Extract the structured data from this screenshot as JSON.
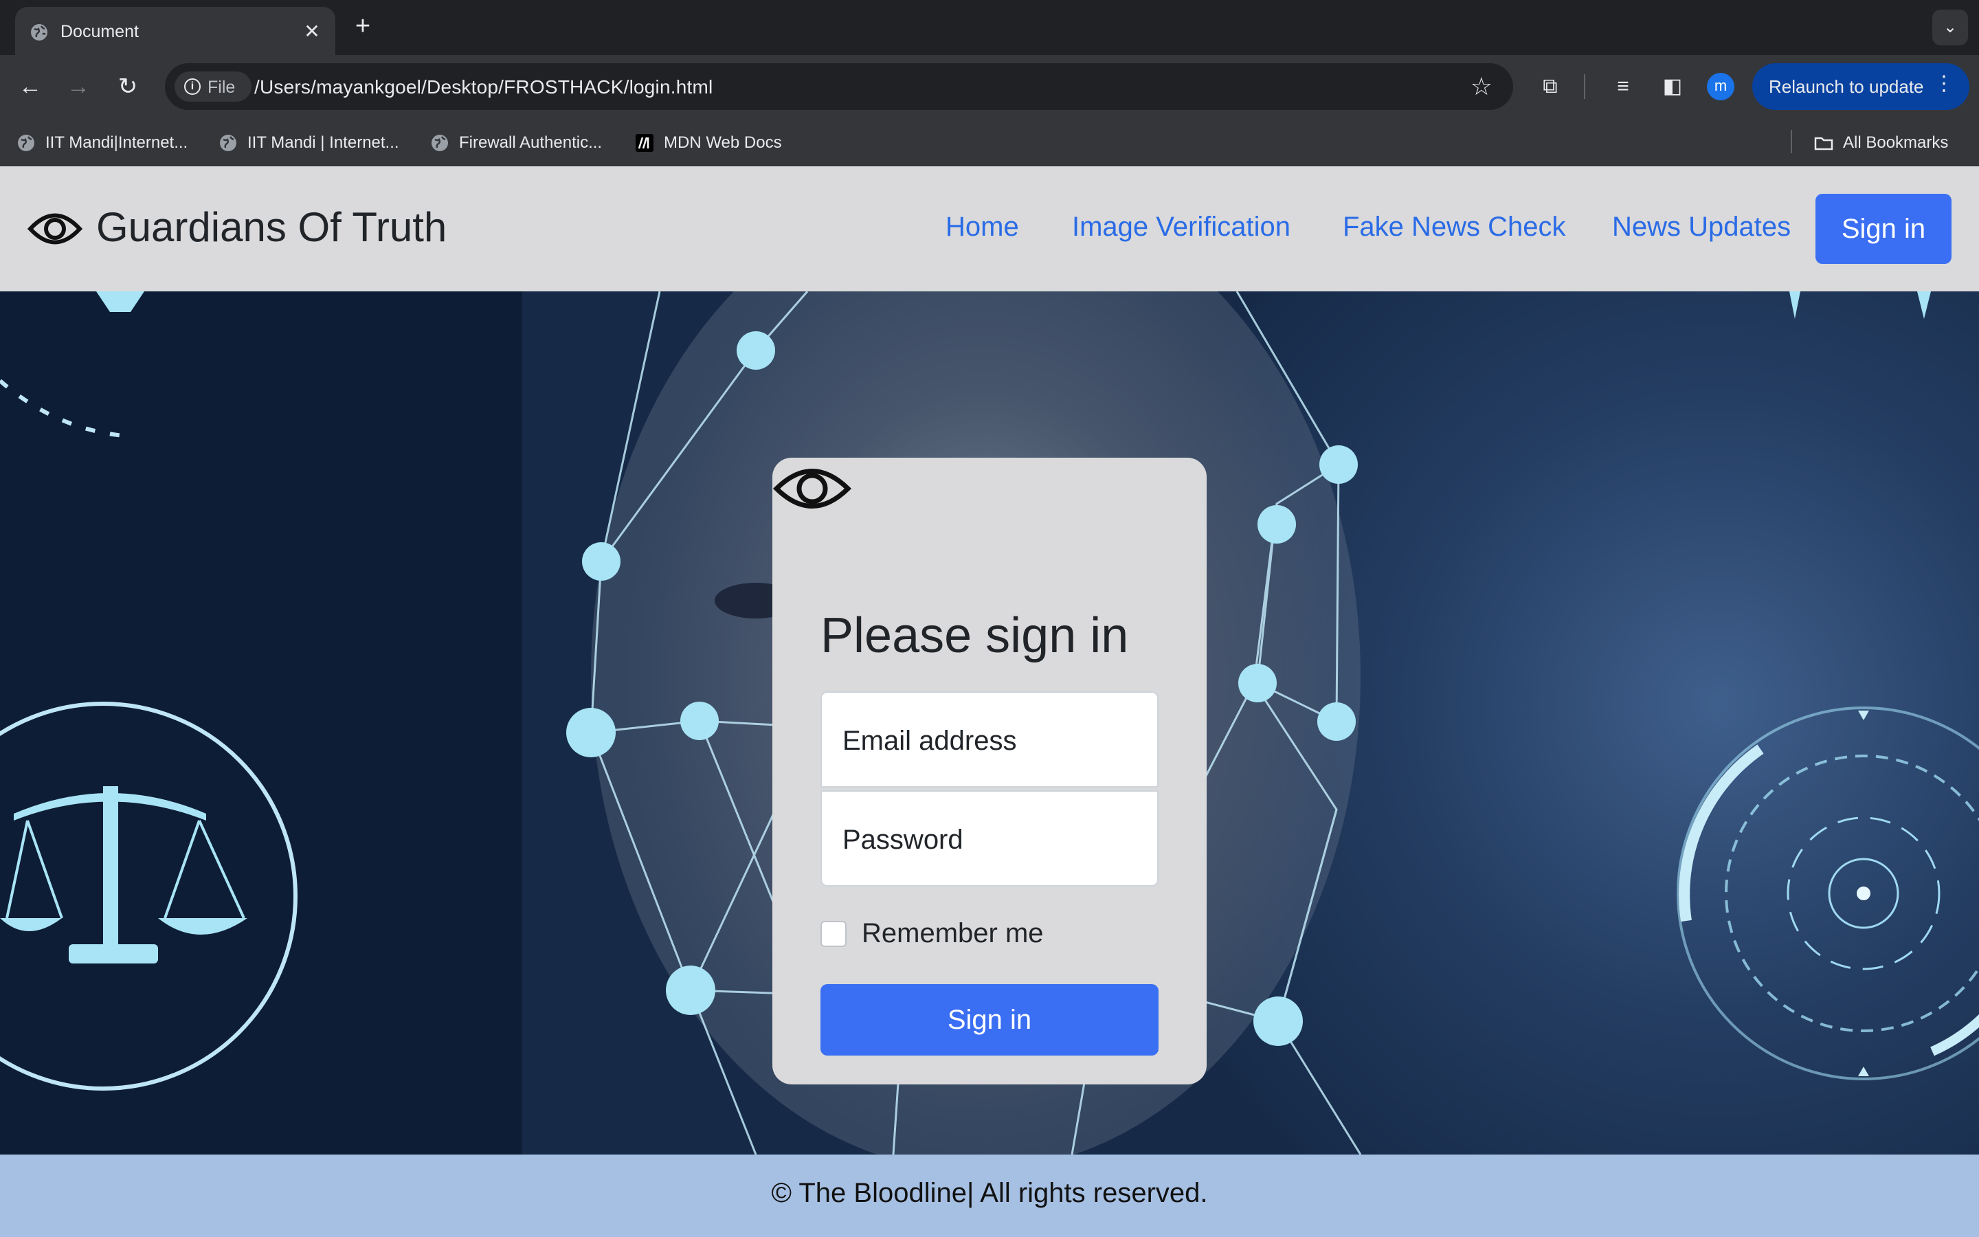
{
  "browser": {
    "tab": {
      "title": "Document",
      "close_glyph": "✕"
    },
    "new_tab_glyph": "+",
    "tab_search_glyph": "⌄",
    "address": {
      "chip_label": "File",
      "url": "/Users/mayankgoel/Desktop/FROSTHACK/login.html"
    },
    "profile_initial": "m",
    "relaunch_label": "Relaunch to update",
    "bookmarks": [
      {
        "label": "IIT Mandi|Internet...",
        "icon": "globe-icon"
      },
      {
        "label": "IIT Mandi | Internet...",
        "icon": "globe-icon"
      },
      {
        "label": "Firewall Authentic...",
        "icon": "globe-icon"
      },
      {
        "label": "MDN Web Docs",
        "icon": "mdn-icon"
      }
    ],
    "all_bookmarks_label": "All Bookmarks"
  },
  "site": {
    "brand": "Guardians Of Truth",
    "nav": [
      "Home",
      "Image Verification",
      "Fake News Check",
      "News Updates"
    ],
    "nav_signin": "Sign in",
    "colors": {
      "primary": "#3b6ff3",
      "link": "#2a6be6",
      "navbar": "#dadadc",
      "footer": "#a6c0e3"
    }
  },
  "login": {
    "heading": "Please sign in",
    "email_label": "Email address",
    "password_label": "Password",
    "remember_label": "Remember me",
    "remember_checked": false,
    "submit_label": "Sign in"
  },
  "footer": {
    "text": "© The Bloodline| All rights reserved."
  }
}
